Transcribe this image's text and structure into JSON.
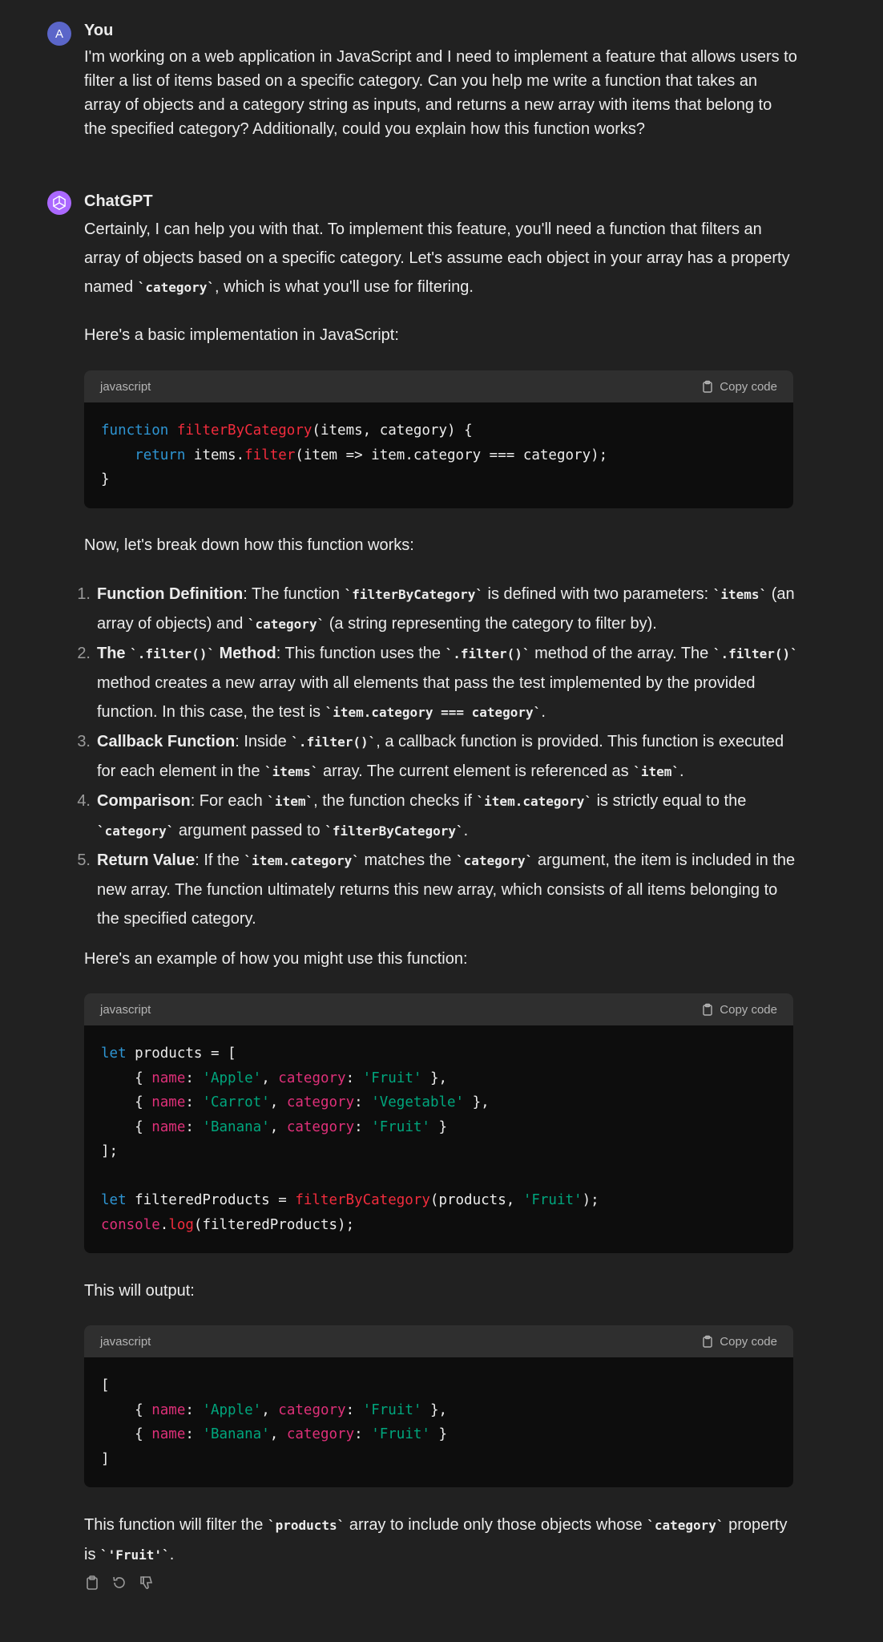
{
  "user": {
    "avatar_letter": "A",
    "name": "You",
    "message": "I'm working on a web application in JavaScript and I need to implement a feature that allows users to filter a list of items based on a specific category. Can you help me write a function that takes an array of objects and a category string as inputs, and returns a new array with items that belong to the specified category? Additionally, could you explain how this function works?"
  },
  "assistant": {
    "name": "ChatGPT",
    "intro_a": "Certainly, I can help you with that. To implement this feature, you'll need a function that filters an array of objects based on a specific category. Let's assume each object in your array has a property named ",
    "intro_code": "`category`",
    "intro_b": ", which is what you'll use for filtering.",
    "impl_text": "Here's a basic implementation in JavaScript:",
    "breakdown_text": "Now, let's break down how this function works:",
    "example_text": "Here's an example of how you might use this function:",
    "output_text": "This will output:",
    "final_a": "This function will filter the ",
    "final_code1": "`products`",
    "final_b": " array to include only those objects whose ",
    "final_code2": "`category`",
    "final_c": " property is ",
    "final_code3": "`'Fruit'`",
    "final_d": "."
  },
  "code_blocks": {
    "language": "javascript",
    "copy_label": "Copy code"
  },
  "code1": {
    "l1_kw": "function",
    "l1_fn": "filterByCategory",
    "l1_rest": "(items, category) {",
    "l2_indent": "    ",
    "l2_kw": "return",
    "l2_a": " items.",
    "l2_fn": "filter",
    "l2_b": "(item => item.category === category);",
    "l3": "}"
  },
  "code2": {
    "l1_kw": "let",
    "l1_rest": " products = [",
    "rows": [
      {
        "p1": "name",
        "v1": "'Apple'",
        "p2": "category",
        "v2": "'Fruit'",
        "end": " },"
      },
      {
        "p1": "name",
        "v1": "'Carrot'",
        "p2": "category",
        "v2": "'Vegetable'",
        "end": " },"
      },
      {
        "p1": "name",
        "v1": "'Banana'",
        "p2": "category",
        "v2": "'Fruit'",
        "end": " }"
      }
    ],
    "close": "];",
    "l7_kw": "let",
    "l7_a": " filteredProducts = ",
    "l7_fn": "filterByCategory",
    "l7_b": "(products, ",
    "l7_str": "'Fruit'",
    "l7_c": ");",
    "l8_obj": "console",
    "l8_dot": ".",
    "l8_fn": "log",
    "l8_rest": "(filteredProducts);"
  },
  "code3": {
    "open": "[",
    "rows": [
      {
        "p1": "name",
        "v1": "'Apple'",
        "p2": "category",
        "v2": "'Fruit'",
        "end": " },"
      },
      {
        "p1": "name",
        "v1": "'Banana'",
        "p2": "category",
        "v2": "'Fruit'",
        "end": " }"
      }
    ],
    "close": "]"
  },
  "list": [
    {
      "num": "1.",
      "title": "Function Definition",
      "a": ": The function ",
      "c1": "`filterByCategory`",
      "b": " is defined with two parameters: ",
      "c2": "`items`",
      "c": " (an array of objects) and ",
      "c3": "`category`",
      "d": " (a string representing the category to filter by)."
    },
    {
      "num": "2.",
      "title_a": "The ",
      "title_code": "`.filter()`",
      "title_b": " Method",
      "a": ": This function uses the ",
      "c1": "`.filter()`",
      "b": " method of the array. The ",
      "c2": "`.filter()`",
      "c": " method creates a new array with all elements that pass the test implemented by the provided function. In this case, the test is ",
      "c3": "`item.category === category`",
      "d": "."
    },
    {
      "num": "3.",
      "title": "Callback Function",
      "a": ": Inside ",
      "c1": "`.filter()`",
      "b": ", a callback function is provided. This function is executed for each element in the ",
      "c2": "`items`",
      "c": " array. The current element is referenced as ",
      "c3": "`item`",
      "d": "."
    },
    {
      "num": "4.",
      "title": "Comparison",
      "a": ": For each ",
      "c1": "`item`",
      "b": ", the function checks if ",
      "c2": "`item.category`",
      "c": " is strictly equal to the ",
      "c3": "`category`",
      "d": " argument passed to ",
      "c4": "`filterByCategory`",
      "e": "."
    },
    {
      "num": "5.",
      "title": "Return Value",
      "a": ": If the ",
      "c1": "`item.category`",
      "b": " matches the ",
      "c2": "`category`",
      "c": " argument, the item is included in the new array. The function ultimately returns this new array, which consists of all items belonging to the specified category."
    }
  ],
  "actions": {
    "icons": [
      "clipboard-icon",
      "regenerate-icon",
      "thumbs-down-icon"
    ]
  },
  "colors": {
    "background": "#212121",
    "code_bg": "#0d0d0d",
    "code_header": "#2f2f2f",
    "keyword": "#2e95d3",
    "function": "#f22c3d",
    "property": "#df3079",
    "string": "#00a67d"
  }
}
